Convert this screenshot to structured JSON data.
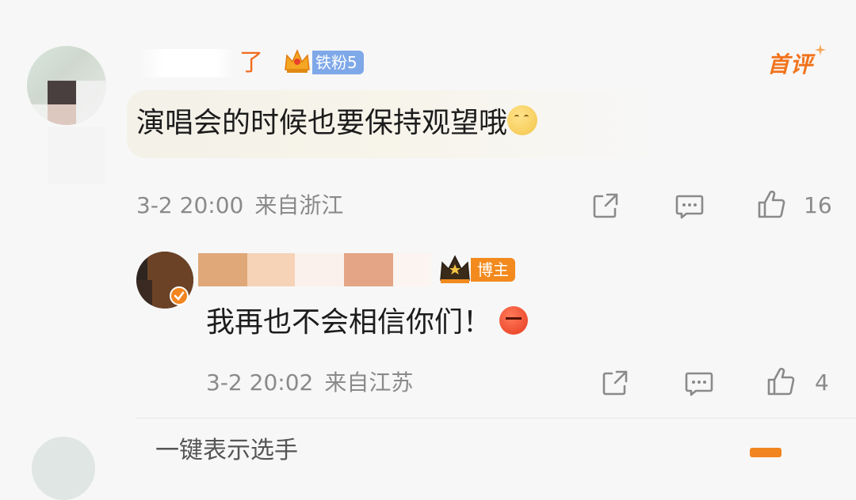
{
  "comment": {
    "username_visible_suffix": "了",
    "fan_badge_label": "铁粉5",
    "first_comment_tag": "首评",
    "text": "演唱会的时候也要保持观望哦",
    "date": "3-2 20:00",
    "location": "来自浙江",
    "like_count": "16"
  },
  "reply": {
    "host_badge_label": "博主",
    "text": "我再也不会相信你们！",
    "date": "3-2 20:02",
    "location": "来自江苏",
    "like_count": "4"
  },
  "next_comment": {
    "username_visible": "一键表示选手"
  },
  "colors": {
    "accent_orange": "#f2731c",
    "fan_badge_blue": "#7fa8e8",
    "host_badge_orange": "#f28a1e",
    "meta_gray": "#8a8a8a"
  },
  "icons": [
    "crown-icon",
    "share-icon",
    "comment-icon",
    "thumbs-up-icon",
    "verified-badge-icon",
    "thinking-emoji",
    "angry-emoji"
  ]
}
